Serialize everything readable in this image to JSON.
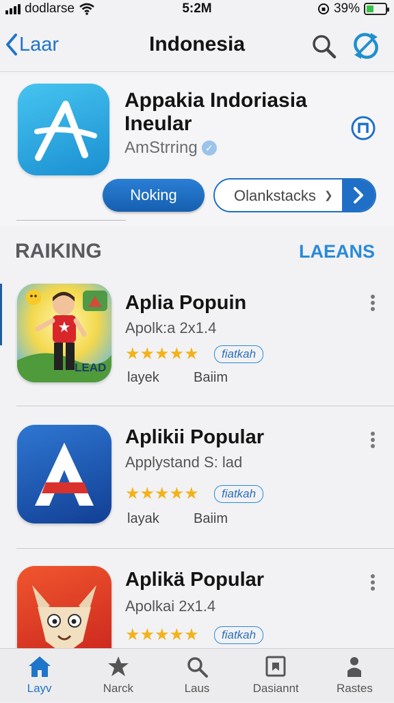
{
  "status_bar": {
    "carrier": "dodlarse",
    "time": "5:2M",
    "battery": "39%",
    "battery_level": 0.39
  },
  "nav": {
    "back_label": "Laar",
    "title": "Indonesia"
  },
  "featured": {
    "title": "Appakia Indoriasia Ineular",
    "developer": "AmStrring",
    "primary_button": "Noking",
    "select_value": "Olankstacks"
  },
  "section": {
    "title": "RAIKING",
    "link": "LAEANS"
  },
  "apps": [
    {
      "title": "Aplia Popuin",
      "subtitle": "Apolk:a 2x1.4",
      "rating": 5,
      "tag": "fiatkah",
      "meta1": "layek",
      "meta2": "Baiim",
      "icon_text": "LEAD"
    },
    {
      "title": "Aplikii Popular",
      "subtitle": "Applystand S: lad",
      "rating": 5,
      "tag": "fiatkah",
      "meta1": "layak",
      "meta2": "Baiim"
    },
    {
      "title": "Aplikä Popular",
      "subtitle": "Apolkai 2x1.4",
      "rating": 5,
      "tag": "fiatkah"
    }
  ],
  "tabs": [
    {
      "label": "Layv",
      "icon": "home-icon",
      "active": true
    },
    {
      "label": "Narck",
      "icon": "star-icon",
      "active": false
    },
    {
      "label": "Laus",
      "icon": "search-icon",
      "active": false
    },
    {
      "label": "Dasiannt",
      "icon": "bookmark-icon",
      "active": false
    },
    {
      "label": "Rastes",
      "icon": "person-icon",
      "active": false
    }
  ],
  "colors": {
    "accent": "#1f75c9",
    "star": "#f3b21a",
    "battery": "#36c24a"
  }
}
